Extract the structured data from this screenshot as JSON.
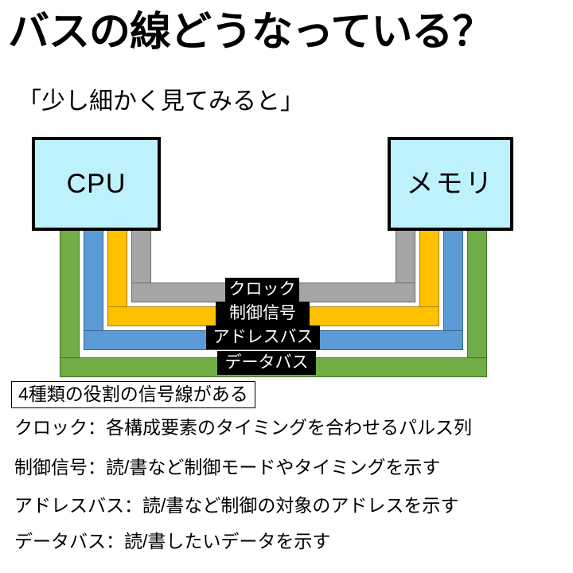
{
  "slide": {
    "title": "バスの線どうなっている？",
    "subtitle": "「少し細かく見てみると」"
  },
  "diagram": {
    "cpu_label": "CPU",
    "memory_label": "メモリ",
    "box_fill_color": "#BDF1FB",
    "box_border_color": "#000000",
    "buses": [
      {
        "id": "clock",
        "label": "クロック",
        "color": "#A5A5A5",
        "order_from_inner": 1
      },
      {
        "id": "control-signal",
        "label": "制御信号",
        "color": "#FFC000",
        "order_from_inner": 2
      },
      {
        "id": "address-bus",
        "label": "アドレスバス",
        "color": "#5B9BD5",
        "order_from_inner": 3
      },
      {
        "id": "data-bus",
        "label": "データバス",
        "color": "#70AD47",
        "order_from_inner": 4
      }
    ]
  },
  "notes": {
    "headline": "4種類の役割の信号線がある",
    "lines": [
      "クロック：各構成要素のタイミングを合わせるパルス列",
      "制御信号：読/書など制御モードやタイミングを示す",
      "アドレスバス：読/書など制御の対象のアドレスを示す",
      "データバス：読/書したいデータを示す"
    ]
  }
}
